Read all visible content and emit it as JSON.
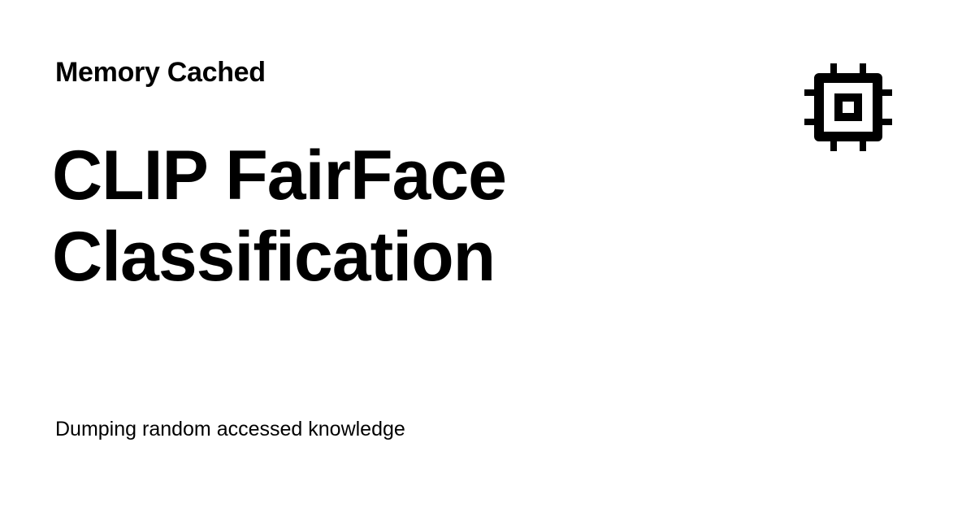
{
  "header": {
    "site_name": "Memory Cached",
    "logo_icon": "chip-icon"
  },
  "main": {
    "title": "CLIP FairFace Classification"
  },
  "footer": {
    "tagline": "Dumping random accessed knowledge"
  },
  "colors": {
    "background": "#ffffff",
    "text": "#000000"
  }
}
